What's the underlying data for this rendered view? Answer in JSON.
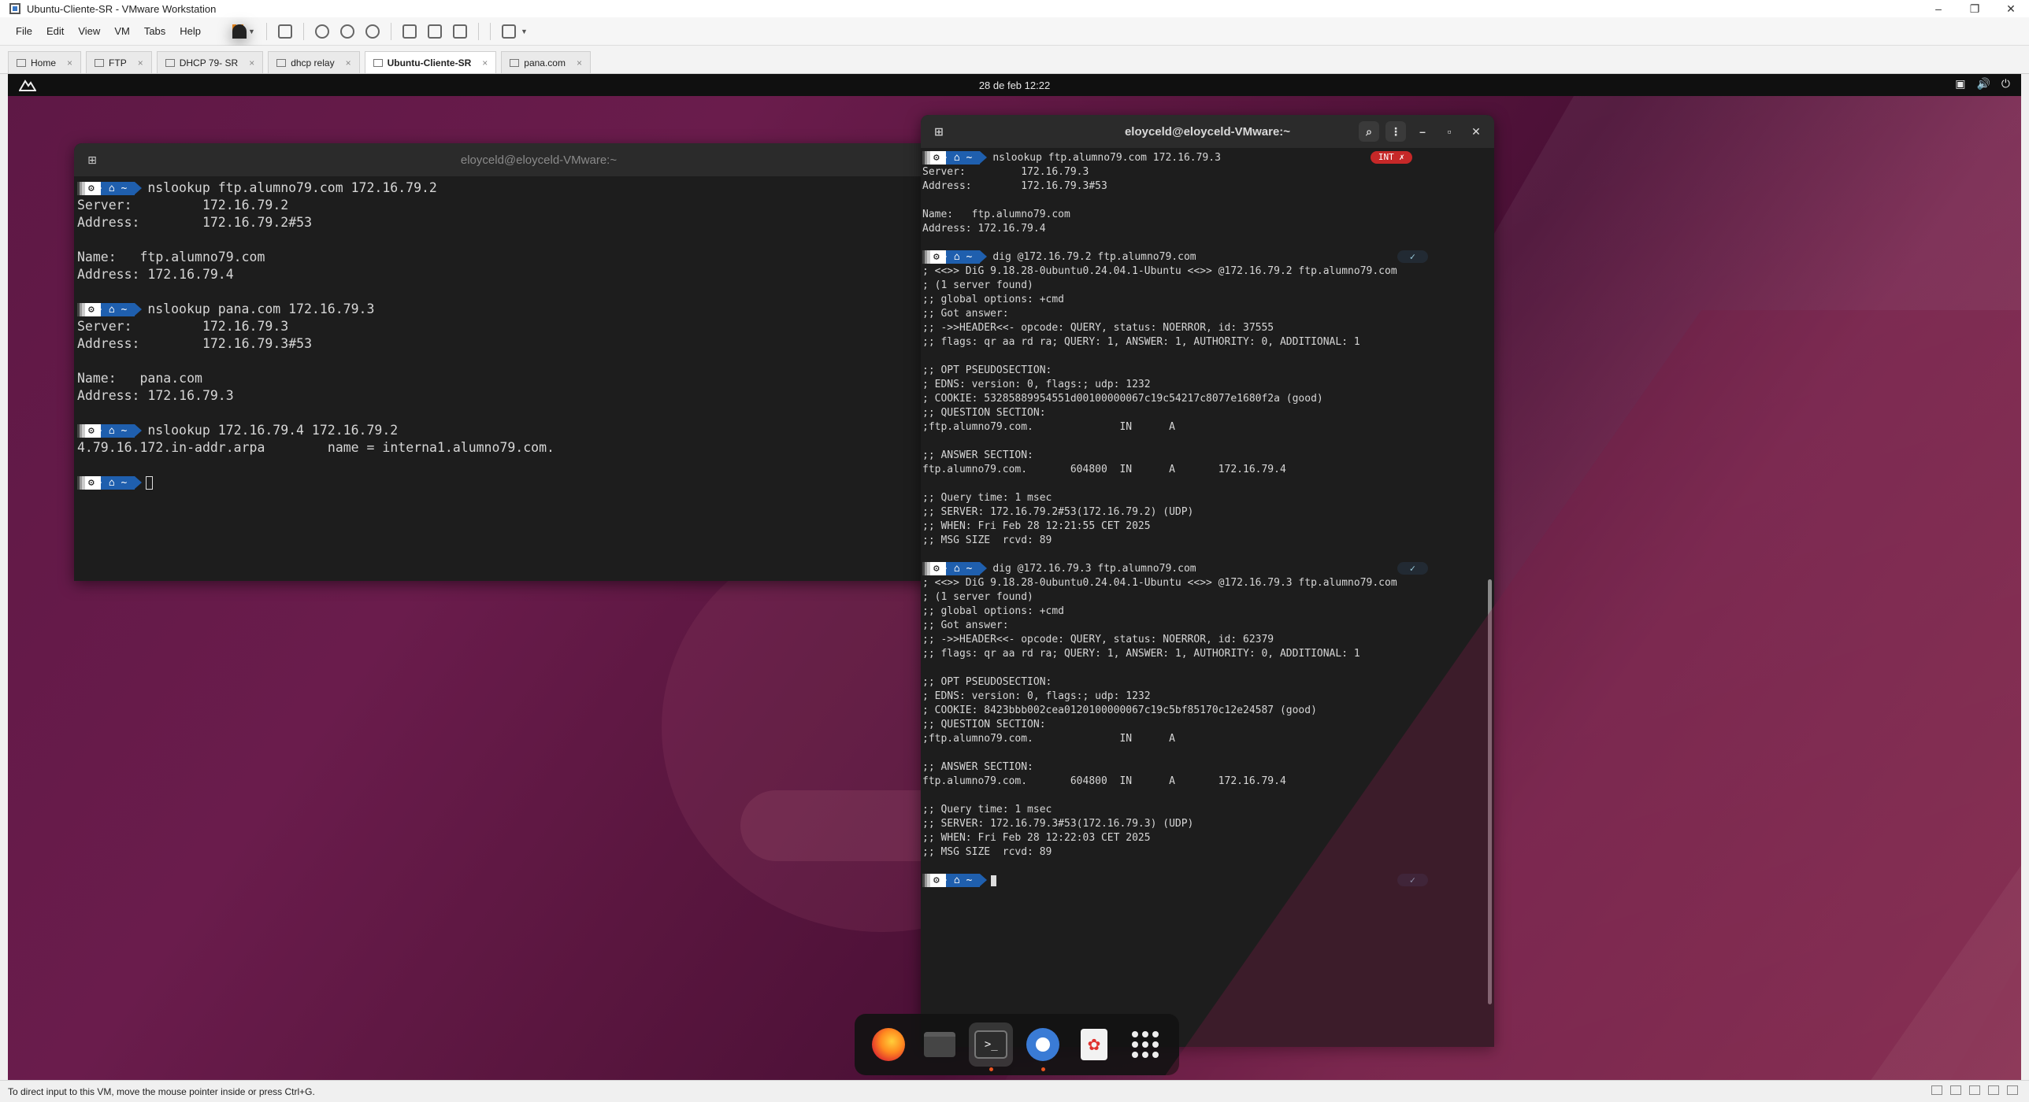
{
  "window": {
    "title": "Ubuntu-Cliente-SR - VMware Workstation",
    "minimize": "–",
    "maximize": "❐",
    "close": "✕"
  },
  "menu": [
    "File",
    "Edit",
    "View",
    "VM",
    "Tabs",
    "Help"
  ],
  "tabs": [
    {
      "label": "Home",
      "active": false
    },
    {
      "label": "FTP",
      "active": false
    },
    {
      "label": "DHCP 79- SR",
      "active": false
    },
    {
      "label": "dhcp relay",
      "active": false
    },
    {
      "label": "Ubuntu-Cliente-SR",
      "active": true
    },
    {
      "label": "pana.com",
      "active": false
    }
  ],
  "tab_close": "×",
  "guest": {
    "clock": "28 de feb  12:22"
  },
  "term_left": {
    "title": "eloyceld@eloyceld-VMware:~",
    "home_seg": "~",
    "blocks": [
      {
        "cmd": "nslookup ftp.alumno79.com 172.16.79.2",
        "output": "Server:         172.16.79.2\nAddress:        172.16.79.2#53\n\nName:   ftp.alumno79.com\nAddress: 172.16.79.4\n"
      },
      {
        "cmd": "nslookup pana.com 172.16.79.3",
        "output": "Server:         172.16.79.3\nAddress:        172.16.79.3#53\n\nName:   pana.com\nAddress: 172.16.79.3\n"
      },
      {
        "cmd": "nslookup 172.16.79.4 172.16.79.2",
        "output": "4.79.16.172.in-addr.arpa        name = interna1.alumno79.com.\n"
      }
    ]
  },
  "term_right": {
    "title": "eloyceld@eloyceld-VMware:~",
    "home_seg": "~",
    "badge_int": "INT ✗",
    "badge_ok": "✓",
    "blocks": [
      {
        "cmd": "nslookup ftp.alumno79.com 172.16.79.3",
        "badge": "int",
        "output": "Server:         172.16.79.3\nAddress:        172.16.79.3#53\n\nName:   ftp.alumno79.com\nAddress: 172.16.79.4\n"
      },
      {
        "cmd": "dig @172.16.79.2 ftp.alumno79.com",
        "badge": "ok",
        "output": "; <<>> DiG 9.18.28-0ubuntu0.24.04.1-Ubuntu <<>> @172.16.79.2 ftp.alumno79.com\n; (1 server found)\n;; global options: +cmd\n;; Got answer:\n;; ->>HEADER<<- opcode: QUERY, status: NOERROR, id: 37555\n;; flags: qr aa rd ra; QUERY: 1, ANSWER: 1, AUTHORITY: 0, ADDITIONAL: 1\n\n;; OPT PSEUDOSECTION:\n; EDNS: version: 0, flags:; udp: 1232\n; COOKIE: 53285889954551d00100000067c19c54217c8077e1680f2a (good)\n;; QUESTION SECTION:\n;ftp.alumno79.com.              IN      A\n\n;; ANSWER SECTION:\nftp.alumno79.com.       604800  IN      A       172.16.79.4\n\n;; Query time: 1 msec\n;; SERVER: 172.16.79.2#53(172.16.79.2) (UDP)\n;; WHEN: Fri Feb 28 12:21:55 CET 2025\n;; MSG SIZE  rcvd: 89\n"
      },
      {
        "cmd": "dig @172.16.79.3 ftp.alumno79.com",
        "badge": "ok",
        "output": "; <<>> DiG 9.18.28-0ubuntu0.24.04.1-Ubuntu <<>> @172.16.79.3 ftp.alumno79.com\n; (1 server found)\n;; global options: +cmd\n;; Got answer:\n;; ->>HEADER<<- opcode: QUERY, status: NOERROR, id: 62379\n;; flags: qr aa rd ra; QUERY: 1, ANSWER: 1, AUTHORITY: 0, ADDITIONAL: 1\n\n;; OPT PSEUDOSECTION:\n; EDNS: version: 0, flags:; udp: 1232\n; COOKIE: 8423bbb002cea0120100000067c19c5bf85170c12e24587 (good)\n;; QUESTION SECTION:\n;ftp.alumno79.com.              IN      A\n\n;; ANSWER SECTION:\nftp.alumno79.com.       604800  IN      A       172.16.79.4\n\n;; Query time: 1 msec\n;; SERVER: 172.16.79.3#53(172.16.79.3) (UDP)\n;; WHEN: Fri Feb 28 12:22:03 CET 2025\n;; MSG SIZE  rcvd: 89\n"
      }
    ]
  },
  "dock": [
    {
      "name": "firefox-icon",
      "label": ""
    },
    {
      "name": "files-icon",
      "label": ""
    },
    {
      "name": "terminal-icon",
      "label": ">_"
    },
    {
      "name": "toggle-app-icon",
      "label": ""
    },
    {
      "name": "software-icon",
      "label": "✿"
    },
    {
      "name": "app-grid-icon",
      "label": ""
    }
  ],
  "status": {
    "text": "To direct input to this VM, move the mouse pointer inside or press Ctrl+G."
  },
  "colors": {
    "prompt_home": "#1f5fae",
    "error_badge": "#c62828",
    "accent": "#e95420"
  }
}
